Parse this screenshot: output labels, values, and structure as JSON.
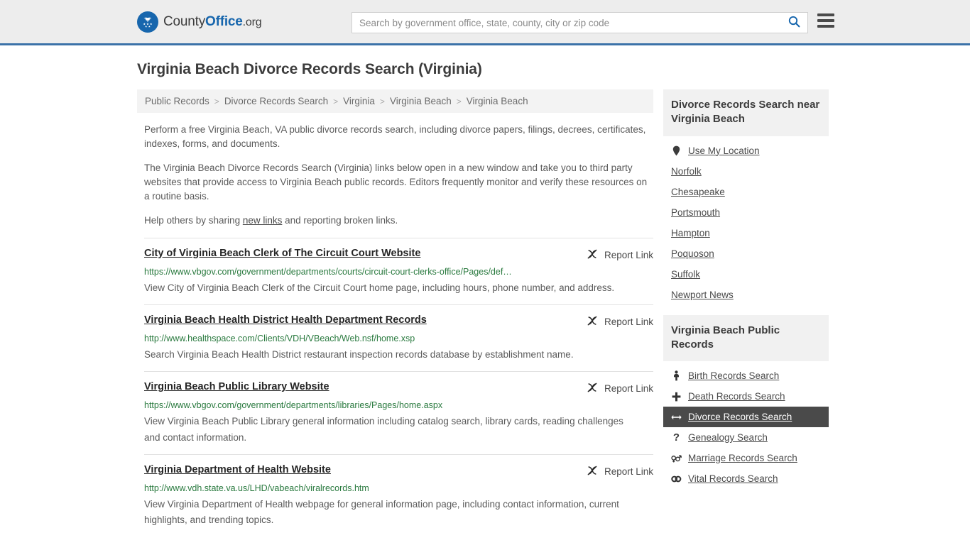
{
  "header": {
    "logo": {
      "part1": "County",
      "part2": "Office",
      "part3": ".org",
      "icon": "eagle-seal-icon"
    },
    "search": {
      "placeholder": "Search by government office, state, county, city or zip code",
      "value": ""
    },
    "search_icon": "search-icon",
    "menu_icon": "hamburger-menu-icon"
  },
  "page": {
    "title": "Virginia Beach Divorce Records Search (Virginia)"
  },
  "breadcrumb": {
    "items": [
      "Public Records",
      "Divorce Records Search",
      "Virginia",
      "Virginia Beach",
      "Virginia Beach"
    ],
    "separator": ">"
  },
  "intro": {
    "p1": "Perform a free Virginia Beach, VA public divorce records search, including divorce papers, filings, decrees, certificates, indexes, forms, and documents.",
    "p2": "The Virginia Beach Divorce Records Search (Virginia) links below open in a new window and take you to third party websites that provide access to Virginia Beach public records. Editors frequently monitor and verify these resources on a routine basis.",
    "p3_before": "Help others by sharing ",
    "p3_link": "new links",
    "p3_after": " and reporting broken links."
  },
  "results": {
    "report_label": "Report Link",
    "report_icon": "broken-link-icon",
    "items": [
      {
        "title": "City of Virginia Beach Clerk of The Circuit Court Website",
        "url": "https://www.vbgov.com/government/departments/courts/circuit-court-clerks-office/Pages/def…",
        "description": "View City of Virginia Beach Clerk of the Circuit Court home page, including hours, phone number, and address."
      },
      {
        "title": "Virginia Beach Health District Health Department Records",
        "url": "http://www.healthspace.com/Clients/VDH/VBeach/Web.nsf/home.xsp",
        "description": "Search Virginia Beach Health District restaurant inspection records database by establishment name."
      },
      {
        "title": "Virginia Beach Public Library Website",
        "url": "https://www.vbgov.com/government/departments/libraries/Pages/home.aspx",
        "description": "View Virginia Beach Public Library general information including catalog search, library cards, reading challenges and contact information."
      },
      {
        "title": "Virginia Department of Health Website",
        "url": "http://www.vdh.state.va.us/LHD/vabeach/viralrecords.htm",
        "description": "View Virginia Department of Health webpage for general information page, including contact information, current highlights, and trending topics."
      }
    ]
  },
  "sidebar": {
    "nearby": {
      "heading": "Divorce Records Search near Virginia Beach",
      "items": [
        {
          "label": "Use My Location",
          "icon": "map-pin-icon"
        },
        {
          "label": "Norfolk",
          "icon": ""
        },
        {
          "label": "Chesapeake",
          "icon": ""
        },
        {
          "label": "Portsmouth",
          "icon": ""
        },
        {
          "label": "Hampton",
          "icon": ""
        },
        {
          "label": "Poquoson",
          "icon": ""
        },
        {
          "label": "Suffolk",
          "icon": ""
        },
        {
          "label": "Newport News",
          "icon": ""
        }
      ]
    },
    "public_records": {
      "heading": "Virginia Beach Public Records",
      "items": [
        {
          "label": "Birth Records Search",
          "icon": "baby-icon",
          "glyph": "⚲",
          "active": false
        },
        {
          "label": "Death Records Search",
          "icon": "cross-icon",
          "glyph": "✚",
          "active": false
        },
        {
          "label": "Divorce Records Search",
          "icon": "left-right-arrow-icon",
          "glyph": "↔",
          "active": true
        },
        {
          "label": "Genealogy Search",
          "icon": "question-mark-icon",
          "glyph": "?",
          "active": false
        },
        {
          "label": "Marriage Records Search",
          "icon": "venus-mars-icon",
          "glyph": "⚢",
          "active": false
        },
        {
          "label": "Vital Records Search",
          "icon": "rings-icon",
          "glyph": "◉◉",
          "active": false
        }
      ]
    }
  },
  "colors": {
    "brand_blue": "#1766ad",
    "header_border": "#3b72a8",
    "url_green": "#2a7a3f",
    "active_bg": "#4a4a4a"
  }
}
